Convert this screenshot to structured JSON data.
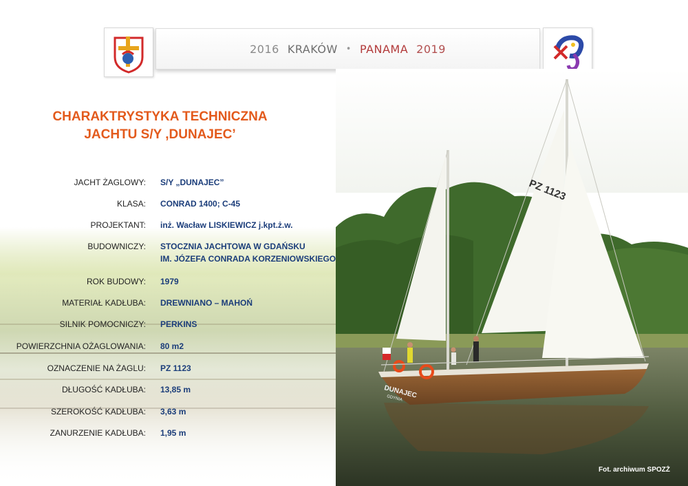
{
  "header": {
    "year_left": "2016",
    "city_left": "KRAKÓW",
    "separator": "•",
    "city_right": "PANAMA",
    "year_right": "2019",
    "logo_left_icon": "wyd-krakow-logo-icon",
    "logo_right_icon": "wyd-panama-logo-icon"
  },
  "title": {
    "line1": "CHARAKTRYSTYKA TECHNICZNA",
    "line2": "JACHTU S/Y ,DUNAJEC’"
  },
  "specs": [
    {
      "label": "JACHT ŻAGLOWY:",
      "value": "S/Y „DUNAJEC”"
    },
    {
      "label": "KLASA:",
      "value": "CONRAD 1400; C-45"
    },
    {
      "label": "PROJEKTANT:",
      "value": "inż. Wacław LISKIEWICZ j.kpt.ż.w."
    },
    {
      "label": "BUDOWNICZY:",
      "value": "STOCZNIA JACHTOWA W GDAŃSKU",
      "value2": "IM. JÓZEFA CONRADA KORZENIOWSKIEGO"
    },
    {
      "label": "ROK BUDOWY:",
      "value": "1979"
    },
    {
      "label": "MATERIAŁ KADŁUBA:",
      "value": "DREWNIANO – MAHOŃ"
    },
    {
      "label": "SILNIK POMOCNICZY:",
      "value": "PERKINS"
    },
    {
      "label": "POWIERZCHNIA OŻAGLOWANIA:",
      "value": "80 m2"
    },
    {
      "label": "OZNACZENIE NA ŻAGLU:",
      "value": "PZ 1123"
    },
    {
      "label": "DŁUGOŚĆ KADŁUBA:",
      "value": "13,85 m"
    },
    {
      "label": "SZEROKOŚĆ KADŁUBA:",
      "value": "3,63 m"
    },
    {
      "label": "ZANURZENIE KADŁUBA:",
      "value": "1,95 m"
    }
  ],
  "photo": {
    "sail_number": "PZ 1123",
    "hull_name": "DUNAJEC",
    "hull_port": "GDYNIA",
    "credit": "Fot. archiwum SPOZŻ"
  },
  "colors": {
    "title": "#e35a1c",
    "value": "#1b3d7a",
    "hull": "#8a5a2e"
  }
}
